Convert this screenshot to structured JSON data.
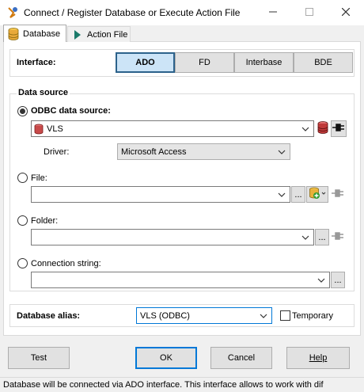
{
  "window": {
    "title": "Connect / Register Database or Execute Action File",
    "minimize_icon": "minimize-icon",
    "maximize_icon": "maximize-icon",
    "close_icon": "close-icon"
  },
  "tabs": [
    {
      "label": "Database",
      "icon": "database-icon",
      "active": true
    },
    {
      "label": "Action File",
      "icon": "play-arrow-icon",
      "active": false
    }
  ],
  "interface": {
    "label": "Interface:",
    "options": [
      "ADO",
      "FD",
      "Interbase",
      "BDE"
    ],
    "selected": "ADO"
  },
  "data_source": {
    "group_label": "Data source",
    "odbc": {
      "label": "ODBC data source:",
      "value": "VLS",
      "selected": true
    },
    "driver": {
      "label": "Driver:",
      "value": "Microsoft Access"
    },
    "file": {
      "label": "File:",
      "value": "",
      "browse_label": "..."
    },
    "folder": {
      "label": "Folder:",
      "value": "",
      "browse_label": "..."
    },
    "connection_string": {
      "label": "Connection string:",
      "value": "",
      "browse_label": "..."
    }
  },
  "alias": {
    "label": "Database alias:",
    "value": "VLS (ODBC)",
    "temporary_label": "Temporary"
  },
  "buttons": {
    "test": "Test",
    "ok": "OK",
    "cancel": "Cancel",
    "help": "Help"
  },
  "status": "Database will be connected via ADO interface. This interface allows to work with dif",
  "colors": {
    "accent": "#0078d7",
    "selected_segment_bg": "#cce4f7",
    "selected_segment_border": "#2c628b"
  }
}
